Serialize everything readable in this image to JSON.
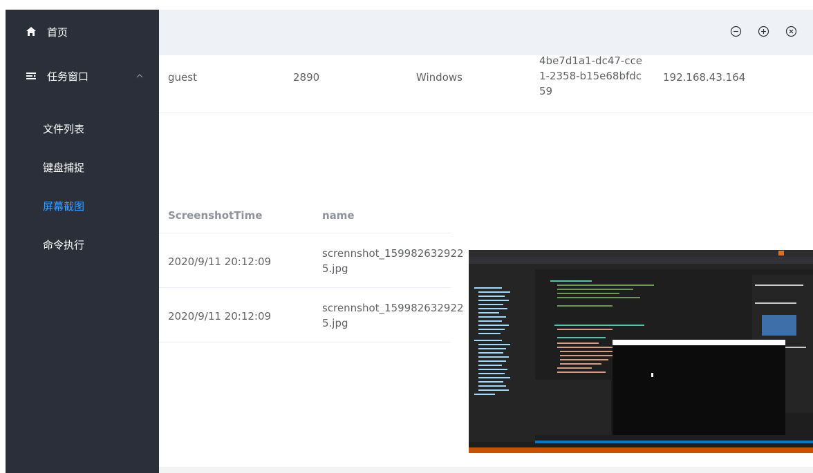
{
  "sidebar": {
    "home_label": "首页",
    "task_label": "任务窗口",
    "sub_items": [
      {
        "label": "文件列表",
        "active": false
      },
      {
        "label": "键盘捕捉",
        "active": false
      },
      {
        "label": "屏幕截图",
        "active": true
      },
      {
        "label": "命令执行",
        "active": false
      }
    ]
  },
  "info_row": {
    "user": "guest",
    "pid": "2890",
    "os": "Windows",
    "uuid": "4be7d1a1-dc47-cce1-2358-b15e68bfdc59",
    "ip": "192.168.43.164"
  },
  "screenshot_table": {
    "headers": {
      "time": "ScreenshotTime",
      "name": "name"
    },
    "rows": [
      {
        "time": "2020/9/11 20:12:09",
        "name": "scrennshot_1599826329225.jpg"
      },
      {
        "time": "2020/9/11 20:12:09",
        "name": "scrennshot_1599826329225.jpg"
      }
    ]
  },
  "colors": {
    "sidebar_bg": "#2b2f3a",
    "active": "#409eff",
    "topbar_bg": "#eef1f6"
  }
}
